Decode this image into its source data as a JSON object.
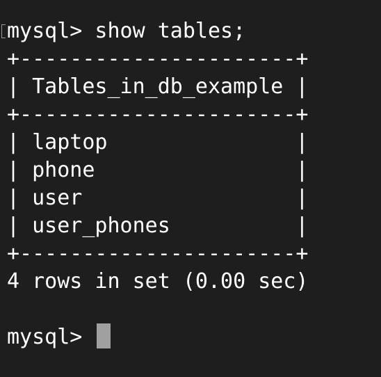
{
  "terminal": {
    "command_line": "mysql> show tables;",
    "table_lines": [
      "+----------------------+",
      "| Tables_in_db_example |",
      "+----------------------+",
      "| laptop               |",
      "| phone                |",
      "| user                 |",
      "| user_phones          |",
      "+----------------------+"
    ],
    "result_summary": "4 rows in set (0.00 sec)",
    "prompt": "mysql> ",
    "colors": {
      "background": "#1e1e1e",
      "text": "#ffffff",
      "cursor": "#a0a0a0"
    }
  }
}
